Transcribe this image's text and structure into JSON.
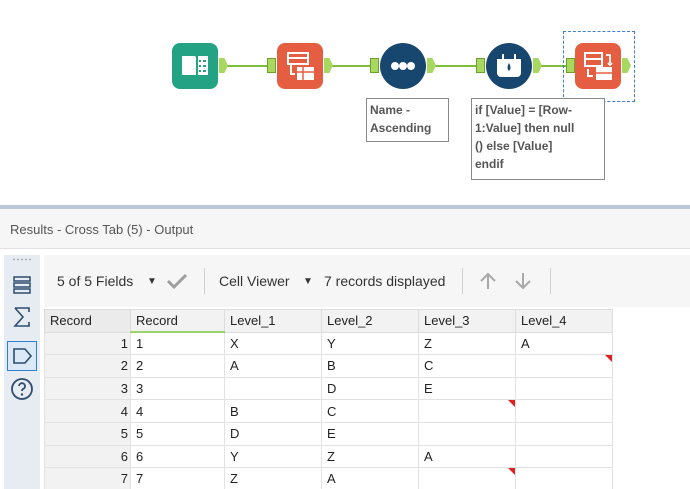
{
  "canvas": {
    "annotations": [
      {
        "text": "Name -\nAscending"
      },
      {
        "text": "if [Value] = [Row-\n1:Value] then null\n() else [Value]\nendif"
      }
    ],
    "tools": [
      "input-data-icon",
      "cross-tab-icon",
      "sort-icon",
      "multi-row-formula-icon",
      "cross-tab-icon"
    ]
  },
  "results": {
    "title": "Results - Cross Tab (5) - Output",
    "toolbar": {
      "fields_label": "5 of 5 Fields",
      "viewer_label": "Cell Viewer",
      "records_label": "7 records displayed"
    },
    "columns": [
      "Record",
      "Record",
      "Level_1",
      "Level_2",
      "Level_3",
      "Level_4"
    ],
    "rows": [
      {
        "n": "1",
        "record": "1",
        "l1": "X",
        "l2": "Y",
        "l3": "Z",
        "l4": "A",
        "null_l3": false,
        "null_l4": false
      },
      {
        "n": "2",
        "record": "2",
        "l1": "A",
        "l2": "B",
        "l3": "C",
        "l4": "",
        "null_l3": false,
        "null_l4": true
      },
      {
        "n": "3",
        "record": "3",
        "l1": "",
        "l2": "D",
        "l3": "E",
        "l4": "",
        "null_l3": false,
        "null_l4": false
      },
      {
        "n": "4",
        "record": "4",
        "l1": "B",
        "l2": "C",
        "l3": "",
        "l4": "",
        "null_l3": true,
        "null_l4": false
      },
      {
        "n": "5",
        "record": "5",
        "l1": "D",
        "l2": "E",
        "l3": "",
        "l4": "",
        "null_l3": false,
        "null_l4": false
      },
      {
        "n": "6",
        "record": "6",
        "l1": "Y",
        "l2": "Z",
        "l3": "A",
        "l4": "",
        "null_l3": false,
        "null_l4": false
      },
      {
        "n": "7",
        "record": "7",
        "l1": "Z",
        "l2": "A",
        "l3": "",
        "l4": "",
        "null_l3": true,
        "null_l4": false
      }
    ],
    "colors": {
      "accent_green": "#7dbe3b",
      "tool_orange": "#e55e42",
      "tool_teal": "#23a383",
      "tool_navy": "#17466e",
      "null_marker": "#e02020"
    }
  }
}
